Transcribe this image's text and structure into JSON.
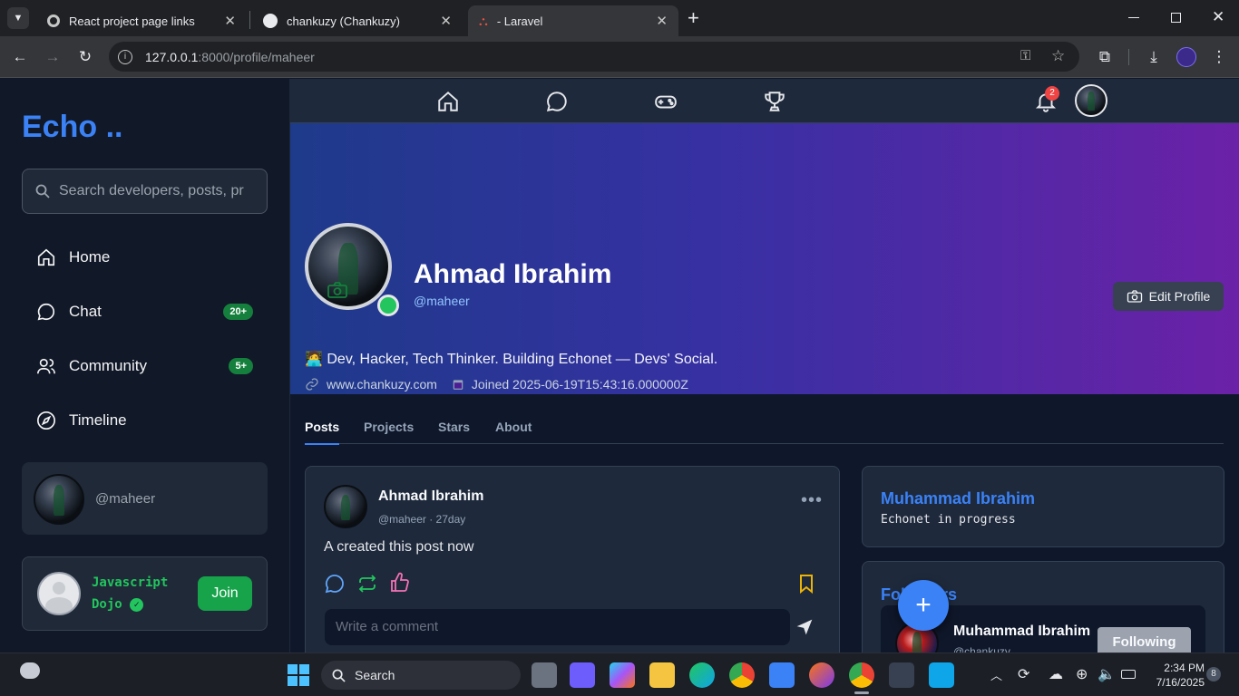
{
  "browser": {
    "tabs": [
      {
        "title": "React project page links",
        "icon": "chrome-settings-icon"
      },
      {
        "title": "chankuzy (Chankuzy)",
        "icon": "github-icon"
      },
      {
        "title": "- Laravel",
        "icon": "laravel-icon"
      }
    ],
    "url_host": "127.0.0.1",
    "url_path": ":8000/profile/maheer"
  },
  "sidebar": {
    "logo": "Echo ..",
    "search_placeholder": "Search developers, posts, pr",
    "items": [
      {
        "label": "Home",
        "icon": "home-icon"
      },
      {
        "label": "Chat",
        "icon": "chat-icon",
        "badge": "20+"
      },
      {
        "label": "Community",
        "icon": "users-icon",
        "badge": "5+"
      },
      {
        "label": "Timeline",
        "icon": "compass-icon"
      }
    ],
    "user_handle": "@maheer",
    "community": {
      "name_line1": "Javascript",
      "name_line2": "Dojo",
      "join_label": "Join"
    }
  },
  "topnav": {
    "notification_count": "2"
  },
  "profile": {
    "name": "Ahmad Ibrahim",
    "handle": "@maheer",
    "edit_label": "Edit Profile",
    "bio": "🧑‍💻 Dev, Hacker, Tech Thinker. Building Echonet — Devs' Social.",
    "website": "www.chankuzy.com",
    "joined": "Joined 2025-06-19T15:43:16.000000Z",
    "tabs": [
      "Posts",
      "Projects",
      "Stars",
      "About"
    ]
  },
  "post": {
    "author": "Ahmad Ibrahim",
    "handle": "@maheer",
    "time": "27day",
    "content": "A created this post now",
    "comment_placeholder": "Write a comment"
  },
  "right_panel": {
    "featured_name": "Muhammad Ibrahim",
    "featured_sub": "Echonet in progress",
    "followers_title": "Followers",
    "follower_name": "Muhammad Ibrahim",
    "follower_handle": "@chankuzy",
    "following_label": "Following"
  },
  "taskbar": {
    "search_label": "Search",
    "time": "2:34 PM",
    "date": "7/16/2025",
    "notif_count": "8"
  },
  "colors": {
    "accent": "#3b82f6",
    "badge_green": "#15803d",
    "online": "#22c55e"
  }
}
